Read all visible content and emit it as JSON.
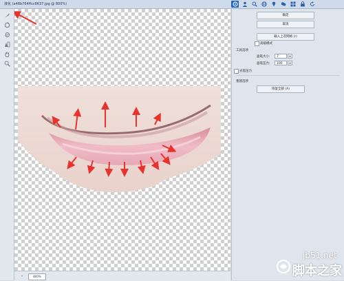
{
  "window": {
    "title": "液化 (a48b764ffcc8637.jpg @ 800%)"
  },
  "top_icons": [
    "liquify-icon",
    "user-icon",
    "search-icon",
    "globe-icon",
    "pin-icon",
    "nature-icon",
    "grid-icon",
    "lock-icon",
    "refresh-icon"
  ],
  "tools": [
    "forward-warp-icon",
    "reconstruct-icon",
    "twirl-icon",
    "freeze-mask-icon",
    "hand-icon",
    "zoom-icon"
  ],
  "panel": {
    "ok_label": "确定",
    "cancel_label": "取消",
    "load_label": "载入上次网格 (r)",
    "advanced_label": "高级模式",
    "tool_options_heading": "工具选项",
    "brush_size_label": "画笔大小:",
    "brush_size_value": "7",
    "brush_pressure_label": "画笔压力:",
    "brush_pressure_value": "100",
    "stylus_label": "光笔压力",
    "rebuild_heading": "重建选项",
    "restore_all_label": "恢复全部 (A)"
  },
  "status": {
    "zoom": "800%"
  },
  "colors": {
    "accent": "#1e63c4",
    "annotation": "#e8322b",
    "lip": "#e6a9b4"
  },
  "watermark": {
    "url": "jb51.net",
    "brand": "脚本之家"
  }
}
